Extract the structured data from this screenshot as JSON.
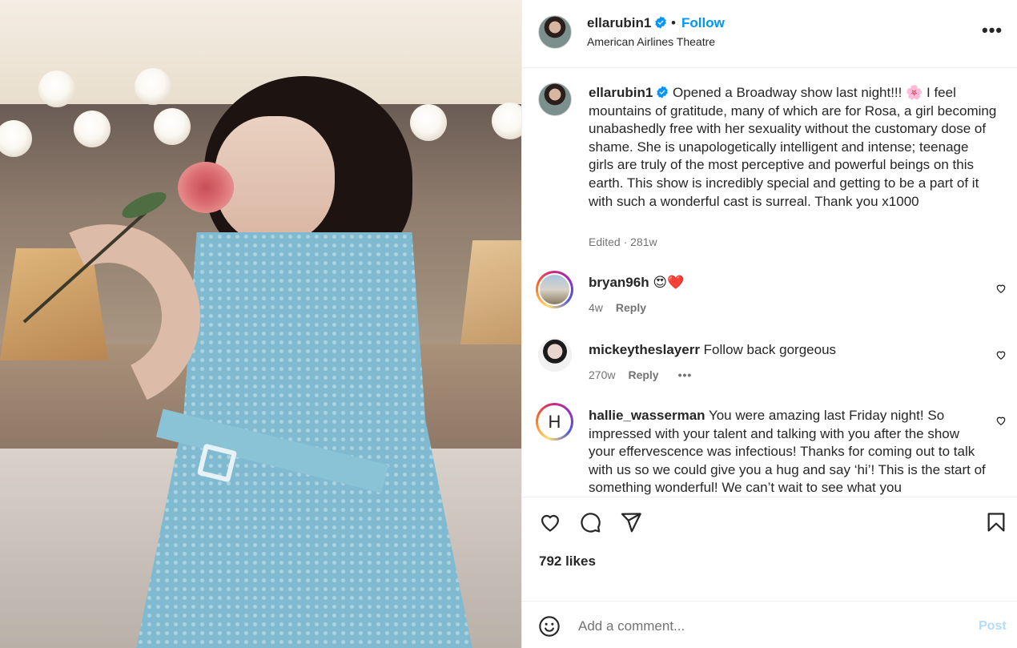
{
  "post": {
    "username": "ellarubin1",
    "follow_label": "Follow",
    "separator": "•",
    "location": "American Airlines Theatre",
    "more_label": "•••"
  },
  "caption": {
    "username": "ellarubin1",
    "text": "Opened a Broadway show last night!!! 🌸 I feel mountains of gratitude, many of which are for Rosa, a girl becoming unabashedly free with her sexuality without the customary dose of shame. She is unapologetically intelligent and intense; teenage girls are truly of the most perceptive and powerful beings on this earth. This show is incredibly special and getting to be a part of it with such a wonderful cast is surreal. Thank you x1000",
    "meta": "Edited · 281w"
  },
  "comments": [
    {
      "username": "bryan96h",
      "text": "😍❤️",
      "age": "4w",
      "reply_label": "Reply"
    },
    {
      "username": "mickeytheslayerr",
      "text": "Follow back gorgeous",
      "age": "270w",
      "reply_label": "Reply",
      "more_label": "•••"
    },
    {
      "username": "hallie_wasserman",
      "avatar_letter": "H",
      "text": "You were amazing last Friday night! So impressed with your talent and talking with you after the show your effervescence was infectious! Thanks for coming out to talk with us so we could give you a hug and say ‘hi’! This is the start of something wonderful! We can’t wait to see what you"
    }
  ],
  "actions": {
    "likes": "792 likes"
  },
  "composer": {
    "placeholder": "Add a comment...",
    "post_label": "Post"
  },
  "colors": {
    "link_blue": "#0095f6",
    "post_disabled": "#b3dbff",
    "verified": "#0095f6"
  },
  "icons": [
    "verified-icon",
    "more-options-icon",
    "heart-icon",
    "comment-icon",
    "share-icon",
    "bookmark-icon",
    "emoji-icon"
  ]
}
